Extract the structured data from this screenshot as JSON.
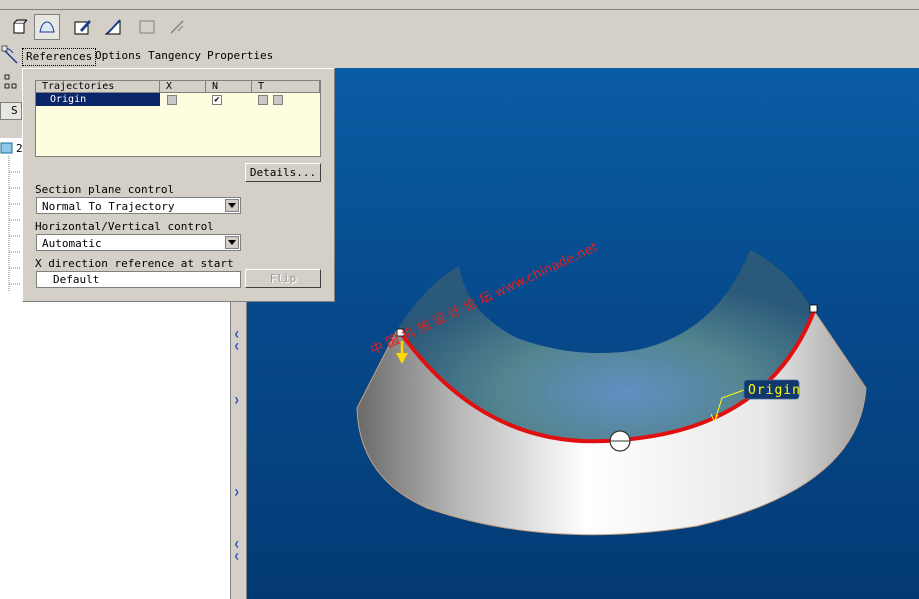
{
  "toolbar": {
    "icons": [
      "solid-icon",
      "surface-icon",
      "sketch-icon",
      "section-icon",
      "rectangle-icon",
      "pencil-icon"
    ]
  },
  "tabs": {
    "references": "References",
    "options": "Options",
    "tangency": "Tangency",
    "properties": "Properties"
  },
  "left_panel": {
    "tab_label": "S",
    "tree_root": "2"
  },
  "references_panel": {
    "table": {
      "headers": [
        "Trajectories",
        "X",
        "N",
        "T"
      ],
      "rows": [
        {
          "name": "Origin",
          "x_checked": false,
          "n_checked": true,
          "t_checked": false
        }
      ]
    },
    "details_button": "Details...",
    "section_plane_label": "Section plane control",
    "section_plane_value": "Normal To Trajectory",
    "hv_label": "Horizontal/Vertical control",
    "hv_value": "Automatic",
    "xdir_label": "X direction reference at start",
    "xdir_value": "Default",
    "flip_button": "Flip"
  },
  "viewport": {
    "origin_label": "Origin",
    "watermark": "中 国 机 械 设 计 论 坛 www.chinade.net",
    "colors": {
      "background": "#064a8c",
      "trajectory": "#e01010",
      "label": "#ffff00"
    }
  }
}
